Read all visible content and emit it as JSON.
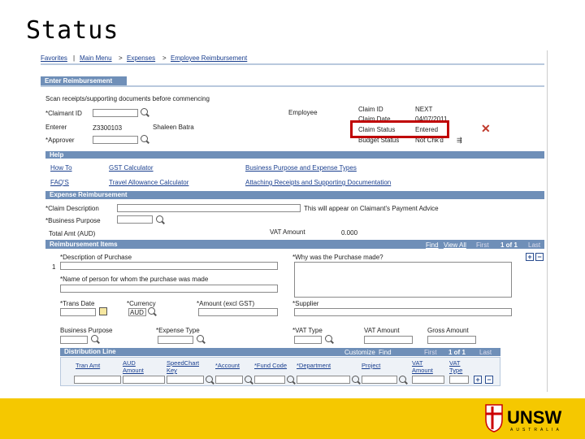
{
  "slide": {
    "title": "Status"
  },
  "breadcrumb": {
    "favorites": "Favorites",
    "main_menu": "Main Menu",
    "expenses": "Expenses",
    "page": "Employee Reimbursement"
  },
  "tab": {
    "label": "Enter Reimbursement"
  },
  "intro": "Scan receipts/supporting documents before commencing",
  "header": {
    "claimant_label": "*Claimant ID",
    "employee_label": "Employee",
    "enterer_label": "Enterer",
    "enterer_id": "Z3300103",
    "enterer_name": "Shaleen Batra",
    "approver_label": "*Approver",
    "claim_id_label": "Claim ID",
    "claim_id_value": "NEXT",
    "claim_date_label": "Claim Date",
    "claim_date_value": "04/07/2011",
    "claim_status_label": "Claim Status",
    "claim_status_value": "Entered",
    "budget_status_label": "Budget Status",
    "budget_status_value": "Not Chk'd"
  },
  "help": {
    "title": "Help",
    "links": [
      "How To",
      "GST Calculator",
      "Business Purpose and Expense Types",
      "FAQ'S",
      "Travel Allowance Calculator",
      "Attaching Receipts and Supporting Documentation"
    ]
  },
  "expense": {
    "title": "Expense Reimbursement",
    "claim_desc_label": "*Claim Description",
    "claim_desc_note": "This will appear on Claimant's Payment Advice",
    "business_purpose_label": "*Business Purpose",
    "total_label": "Total Amt (AUD)",
    "vat_label": "VAT Amount",
    "vat_value": "0.000"
  },
  "items": {
    "title": "Reimbursement Items",
    "nav": {
      "find": "Find",
      "view_all": "View All",
      "first": "First",
      "range": "1 of 1",
      "last": "Last"
    },
    "row_num": "1",
    "desc_label": "*Description of Purchase",
    "why_label": "*Why was the Purchase made?",
    "person_label": "*Name of person for whom the purchase was made",
    "trans_date_label": "*Trans Date",
    "currency_label": "*Currency",
    "currency_value": "AUD",
    "amount_label": "*Amount (excl GST)",
    "supplier_label": "*Supplier",
    "bp_label": "Business Purpose",
    "expense_type_label": "*Expense Type",
    "vat_type_label": "*VAT Type",
    "vat_amount_label": "VAT Amount",
    "gross_label": "Gross Amount"
  },
  "distribution": {
    "title": "Distribution Line",
    "nav": {
      "customize": "Customize",
      "find": "Find",
      "first": "First",
      "range": "1 of 1",
      "last": "Last"
    },
    "columns": [
      "Tran Amt",
      "AUD Amount",
      "SpeedChart Key",
      "*Account",
      "*Fund Code",
      "*Department",
      "Project",
      "VAT Amount",
      "VAT Type"
    ]
  },
  "icons": {
    "lookup": "magnifier-icon",
    "calendar": "calendar-icon",
    "add": "plus-icon",
    "remove": "minus-icon"
  },
  "colors": {
    "bar": "#6f8fb8",
    "footer": "#f5c800",
    "highlight": "#c00000"
  }
}
